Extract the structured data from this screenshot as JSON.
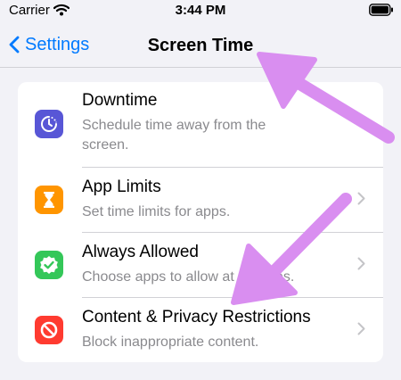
{
  "status_bar": {
    "carrier": "Carrier",
    "time": "3:44 PM"
  },
  "nav": {
    "back_label": "Settings",
    "title": "Screen Time"
  },
  "rows": [
    {
      "title": "Downtime",
      "subtitle": "Schedule time away from the screen.",
      "icon": "downtime-icon",
      "color": "#5856d6"
    },
    {
      "title": "App Limits",
      "subtitle": "Set time limits for apps.",
      "icon": "hourglass-icon",
      "color": "#ff9500"
    },
    {
      "title": "Always Allowed",
      "subtitle": "Choose apps to allow at all times.",
      "icon": "checkmark-seal-icon",
      "color": "#34c759"
    },
    {
      "title": "Content & Privacy Restrictions",
      "subtitle": "Block inappropriate content.",
      "icon": "prohibited-icon",
      "color": "#ff3b30"
    }
  ],
  "colors": {
    "accent": "#007aff",
    "annotation": "#d98ef0"
  }
}
